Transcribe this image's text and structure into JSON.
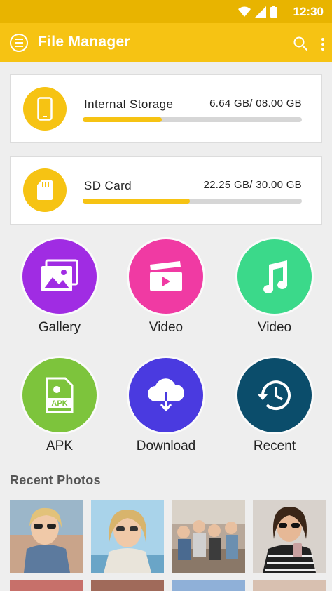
{
  "status_bar": {
    "time": "12:30"
  },
  "app_bar": {
    "title": "File Manager"
  },
  "storage": [
    {
      "name": "Internal Storage",
      "size": "6.64 GB/ 08.00 GB",
      "used_fraction": 0.36,
      "icon": "phone-icon"
    },
    {
      "name": "SD Card",
      "size": "22.25 GB/ 30.00 GB",
      "used_fraction": 0.49,
      "icon": "sd-card-icon"
    }
  ],
  "categories": [
    {
      "label": "Gallery",
      "color": "#a02ce3",
      "icon": "gallery-icon"
    },
    {
      "label": "Video",
      "color": "#f03aa3",
      "icon": "video-clapper-icon"
    },
    {
      "label": "Video",
      "color": "#3bd98a",
      "icon": "music-note-icon"
    },
    {
      "label": "APK",
      "color": "#7dc43c",
      "icon": "apk-file-icon"
    },
    {
      "label": "Download",
      "color": "#4a3ae0",
      "icon": "cloud-download-icon"
    },
    {
      "label": "Recent",
      "color": "#0b4d6b",
      "icon": "history-icon"
    }
  ],
  "recent_photos": {
    "title": "Recent Photos"
  },
  "colors": {
    "accent": "#f6c313",
    "status_bar": "#e8b400"
  }
}
